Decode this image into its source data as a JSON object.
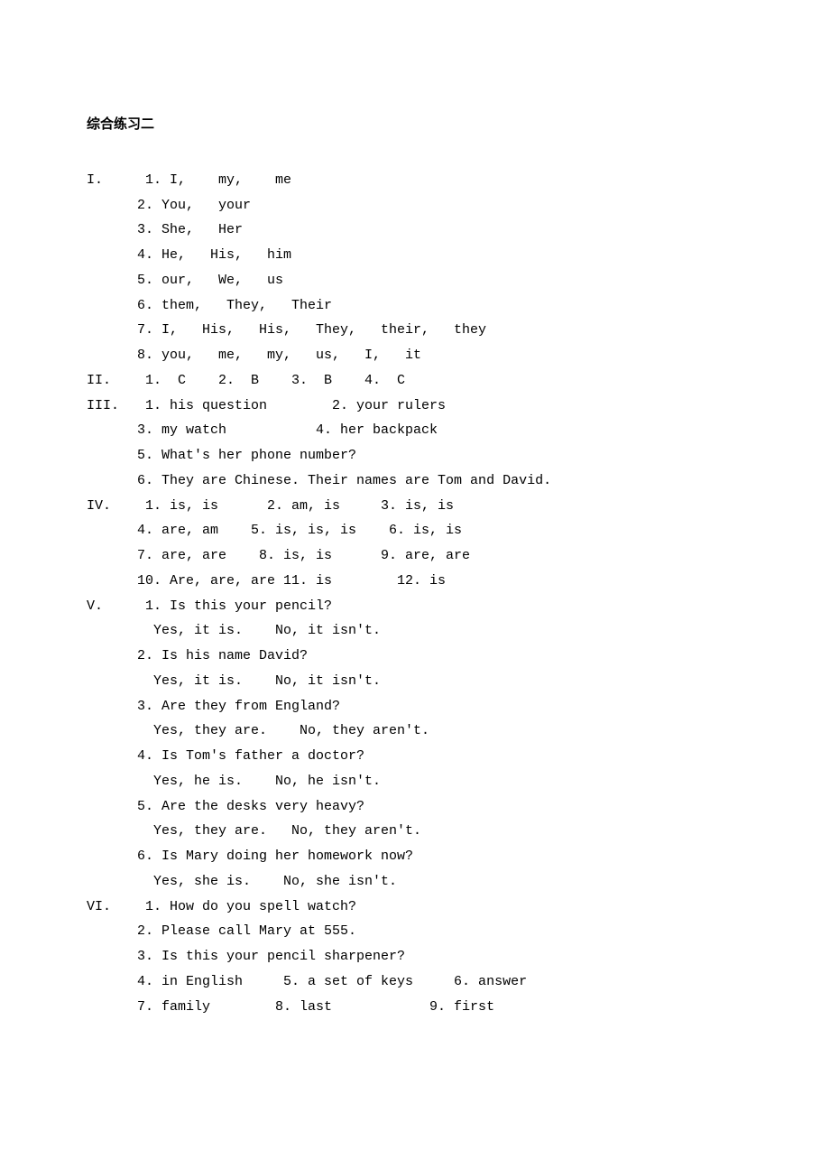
{
  "title": "综合练习二",
  "sections": [
    {
      "label": "I.",
      "lines": [
        " 1. I,    my,    me",
        "2. You,   your",
        "3. She,   Her",
        "4. He,   His,   him",
        "5. our,   We,   us",
        "6. them,   They,   Their",
        "7. I,   His,   His,   They,   their,   they",
        "8. you,   me,   my,   us,   I,   it"
      ]
    },
    {
      "label": "II.",
      "lines": [
        " 1.  C    2.  B    3.  B    4.  C"
      ]
    },
    {
      "label": "III.",
      "lines": [
        " 1. his question        2. your rulers",
        "3. my watch           4. her backpack",
        "5. What's her phone number?",
        "6. They are Chinese. Their names are Tom and David."
      ]
    },
    {
      "label": "IV.",
      "lines": [
        " 1. is, is      2. am, is     3. is, is",
        "4. are, am    5. is, is, is    6. is, is",
        "7. are, are    8. is, is      9. are, are",
        "10. Are, are, are 11. is        12. is"
      ]
    },
    {
      "label": "V.",
      "lines": [
        " 1. Is this your pencil?",
        "  Yes, it is.    No, it isn't.",
        "2. Is his name David?",
        "  Yes, it is.    No, it isn't.",
        "3. Are they from England?",
        "  Yes, they are.    No, they aren't.",
        "4. Is Tom's father a doctor?",
        "  Yes, he is.    No, he isn't.",
        "5. Are the desks very heavy?",
        "  Yes, they are.   No, they aren't.",
        "6. Is Mary doing her homework now?",
        "  Yes, she is.    No, she isn't."
      ]
    },
    {
      "label": "VI.",
      "lines": [
        " 1. How do you spell watch?",
        "2. Please call Mary at 555.",
        "3. Is this your pencil sharpener?",
        "4. in English     5. a set of keys     6. answer",
        "7. family        8. last            9. first"
      ]
    }
  ]
}
